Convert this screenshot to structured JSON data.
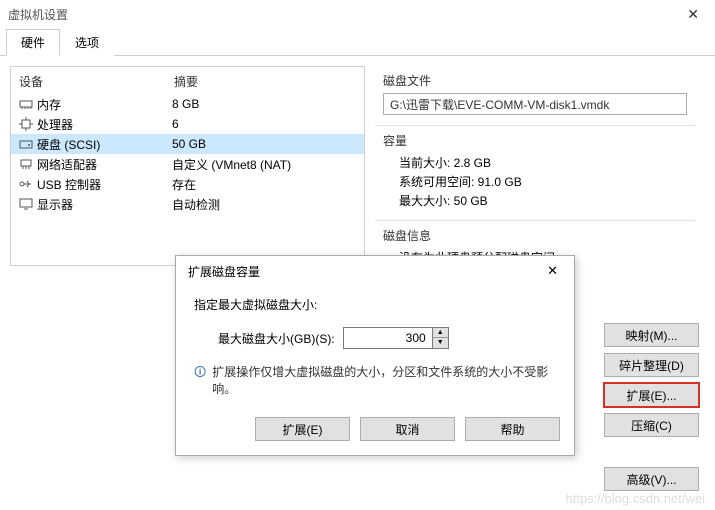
{
  "window": {
    "title": "虚拟机设置"
  },
  "tabs": {
    "hardware": "硬件",
    "options": "选项"
  },
  "headers": {
    "device": "设备",
    "summary": "摘要"
  },
  "devices": [
    {
      "label": "内存",
      "summary": "8 GB",
      "icon": "memory"
    },
    {
      "label": "处理器",
      "summary": "6",
      "icon": "cpu"
    },
    {
      "label": "硬盘 (SCSI)",
      "summary": "50 GB",
      "icon": "disk",
      "selected": true
    },
    {
      "label": "网络适配器",
      "summary": "自定义 (VMnet8 (NAT)",
      "icon": "nic"
    },
    {
      "label": "USB 控制器",
      "summary": "存在",
      "icon": "usb"
    },
    {
      "label": "显示器",
      "summary": "自动检测",
      "icon": "display"
    }
  ],
  "right": {
    "diskfile_label": "磁盘文件",
    "diskfile_path": "G:\\迅雷下载\\EVE-COMM-VM-disk1.vmdk",
    "capacity_label": "容量",
    "current_size": "当前大小: 2.8 GB",
    "free_space": "系统可用空间: 91.0 GB",
    "max_size": "最大大小: 50 GB",
    "diskinfo_label": "磁盘信息",
    "diskinfo_text": "没有为此硬盘预分配磁盘空间。"
  },
  "actions": {
    "map": "映射(M)...",
    "defrag": "碎片整理(D)",
    "expand": "扩展(E)...",
    "compress": "压缩(C)",
    "advanced": "高级(V)..."
  },
  "dialog": {
    "title": "扩展磁盘容量",
    "prompt": "指定最大虚拟磁盘大小:",
    "field_label": "最大磁盘大小(GB)(S):",
    "value": "300",
    "note": "扩展操作仅增大虚拟磁盘的大小，分区和文件系统的大小不受影响。",
    "expand_btn": "扩展(E)",
    "cancel_btn": "取消",
    "help_btn": "帮助"
  },
  "watermark": "https://blog.csdn.net/wei"
}
